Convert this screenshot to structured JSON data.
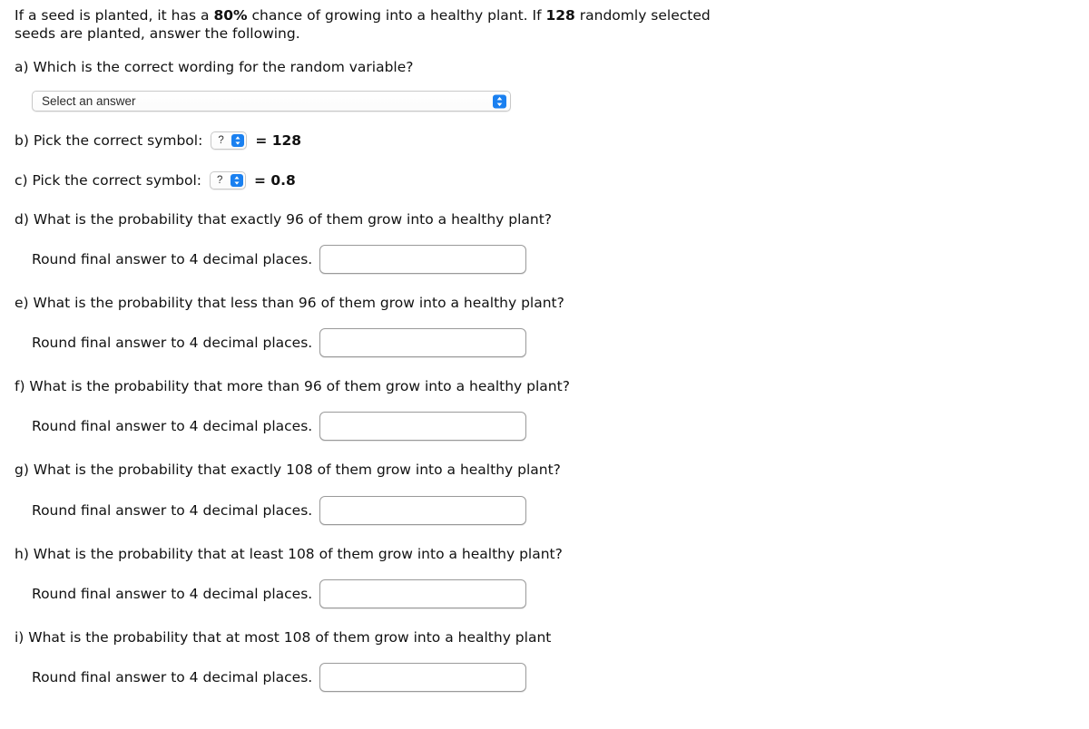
{
  "problem": {
    "intro_part1": "If a seed is planted, it has a ",
    "intro_prob": "80%",
    "intro_part2": " chance of growing into a healthy plant. If ",
    "intro_n": "128",
    "intro_part3": " randomly selected seeds are planted, answer the following."
  },
  "part_a": {
    "question": "a) Which is the correct wording for the random variable?",
    "select_value": "Select an answer",
    "stepper_icon": "stepper-up-down-icon"
  },
  "part_b": {
    "label": "b) Pick the correct symbol:",
    "select_value": "?",
    "equals": "= 128",
    "stepper_icon": "stepper-up-down-icon"
  },
  "part_c": {
    "label": "c) Pick the correct symbol:",
    "select_value": "?",
    "equals": "= 0.8",
    "stepper_icon": "stepper-up-down-icon"
  },
  "part_d": {
    "question": "d) What is the probability that exactly 96 of them grow into a healthy plant?",
    "round_label": "Round final answer to 4 decimal places.",
    "answer_value": "",
    "placeholder": ""
  },
  "part_e": {
    "question": "e) What is the probability that less than 96 of them grow into a healthy plant?",
    "round_label": "Round final answer to 4 decimal places.",
    "answer_value": "",
    "placeholder": ""
  },
  "part_f": {
    "question": "f) What is the probability that more than 96 of them grow into a healthy plant?",
    "round_label": "Round final answer to 4 decimal places.",
    "answer_value": "",
    "placeholder": ""
  },
  "part_g": {
    "question": "g) What is the probability that exactly 108 of them grow into a healthy plant?",
    "round_label": "Round final answer to 4 decimal places.",
    "answer_value": "",
    "placeholder": ""
  },
  "part_h": {
    "question": "h) What is the probability that at least 108 of them grow into a healthy plant?",
    "round_label": "Round final answer to 4 decimal places.",
    "answer_value": "",
    "placeholder": ""
  },
  "part_i": {
    "question": "i) What is the probability that at most 108 of them grow into a healthy plant",
    "round_label": "Round final answer to 4 decimal places.",
    "answer_value": "",
    "placeholder": ""
  },
  "colors": {
    "accent_blue": "#1a80f0",
    "text": "#111111",
    "input_border": "#9a9a9a",
    "select_border": "#c8c8c8",
    "background": "#ffffff"
  }
}
